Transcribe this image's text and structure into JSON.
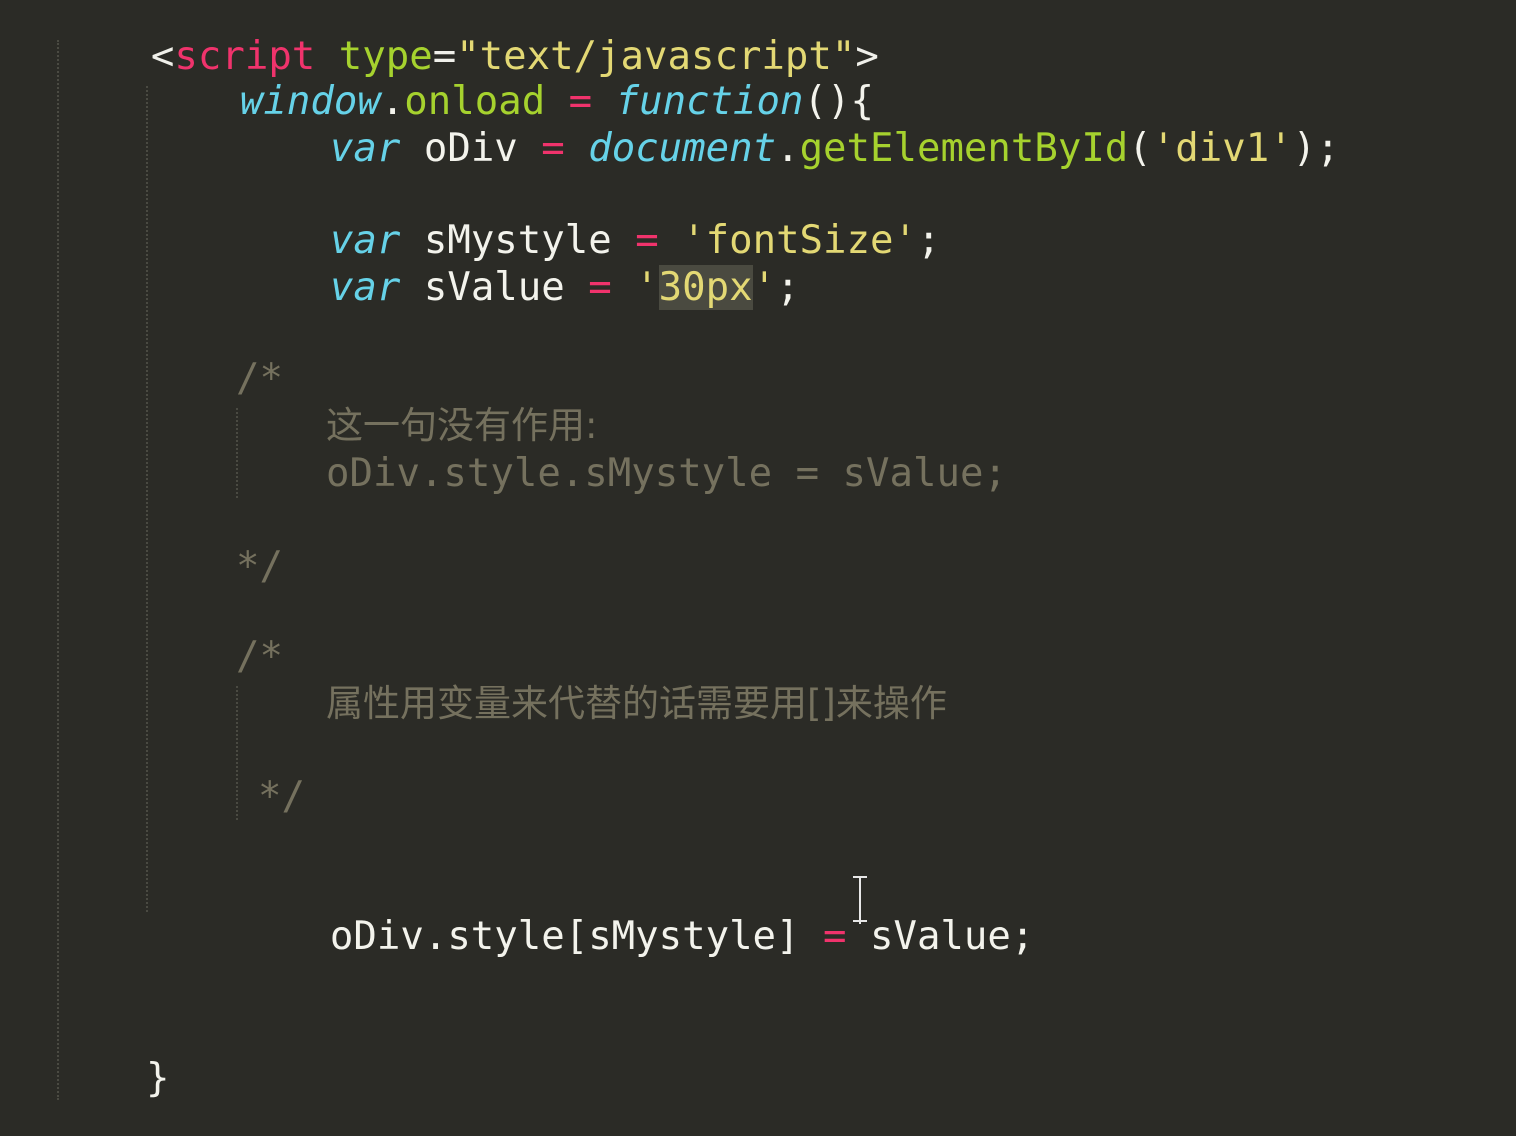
{
  "editor": {
    "theme_colors": {
      "background": "#2b2b26",
      "keyword": "#66d2e8",
      "string": "#e3d874",
      "operator": "#f0336c",
      "function": "#a6d22e",
      "comment": "#75715e"
    },
    "lines": {
      "l1": {
        "lt": "<",
        "tag": "script",
        "sp": " ",
        "attr": "type",
        "eq": "=",
        "val": "\"text/javascript\"",
        "gt": ">"
      },
      "l2": {
        "obj": "window",
        "dot": ".",
        "prop": "onload",
        "op": " = ",
        "kw": "function",
        "rest": "(){"
      },
      "l3": {
        "kw": "var",
        "name": " oDiv ",
        "op": "=",
        "sp": " ",
        "obj": "document",
        "dot": ".",
        "fn": "getElementById",
        "open": "(",
        "str": "'div1'",
        "close": ");"
      },
      "l4": {
        "kw": "var",
        "name": " sMystyle ",
        "op": "=",
        "sp": " ",
        "str": "'fontSize'",
        "end": ";"
      },
      "l5": {
        "kw": "var",
        "name": " sValue ",
        "op": "=",
        "sp": " ",
        "q1": "'",
        "sel": "30px",
        "q2": "'",
        "end": ";"
      },
      "c1_open": "/*",
      "c1_text": "这一句没有作用:",
      "c1_code": "oDiv.style.sMystyle = sValue;",
      "c1_close": "*/",
      "c2_open": "/*",
      "c2_text": "属性用变量来代替的话需要用[]来操作",
      "c2_close": "*/",
      "l_last": {
        "a": "oDiv.style[sMystyle] ",
        "op": "=",
        "b": " sValue;"
      },
      "brace": "}"
    }
  }
}
